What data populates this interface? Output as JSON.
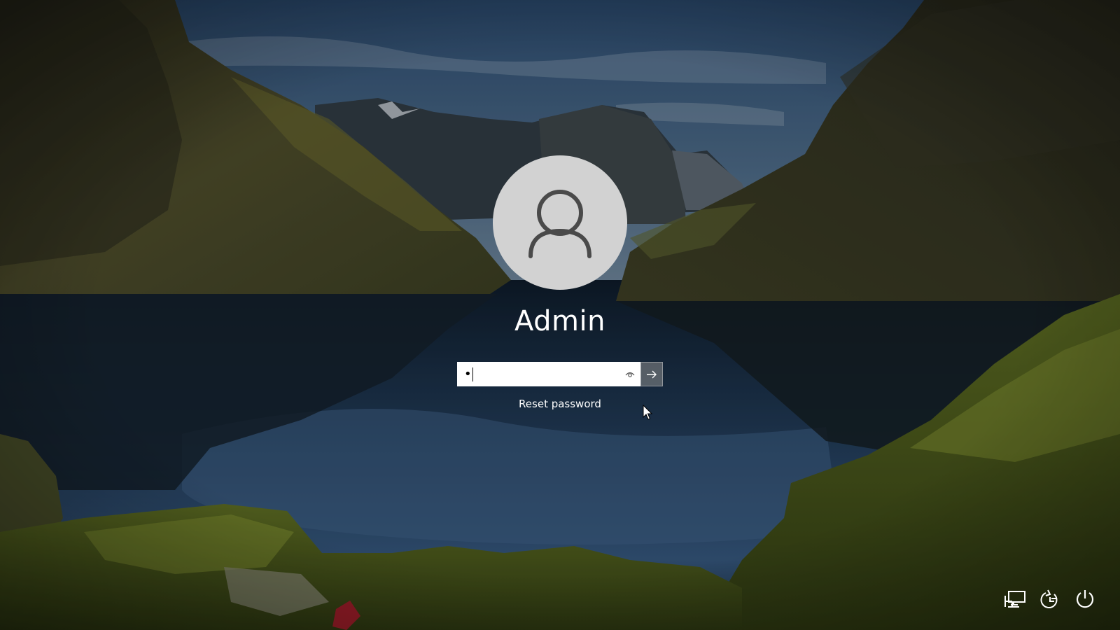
{
  "user": {
    "name": "Admin"
  },
  "password": {
    "masked_value": "•",
    "reveal_icon": "eye-icon",
    "submit_icon": "arrow-right-icon"
  },
  "links": {
    "reset_password": "Reset password"
  },
  "corner_buttons": [
    {
      "icon": "network-icon"
    },
    {
      "icon": "accessibility-icon"
    },
    {
      "icon": "power-icon"
    }
  ],
  "colors": {
    "avatar_bg": "#d2d2d2",
    "avatar_glyph": "#4a4a4a",
    "text": "#ffffff",
    "submit_bg": "#8c8c8c"
  }
}
